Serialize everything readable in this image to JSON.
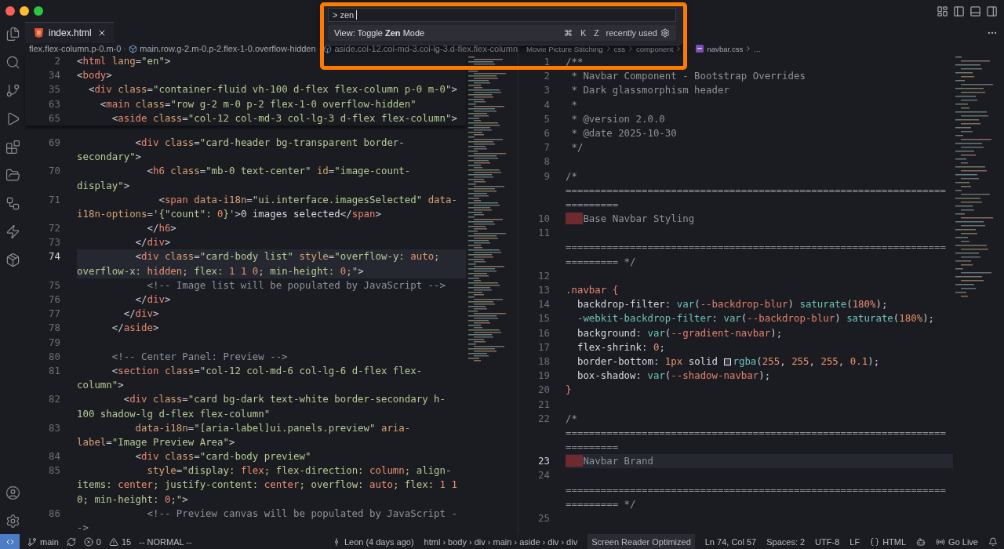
{
  "command_palette": {
    "value": "> zen",
    "item": {
      "label": "View: Toggle **Zen** Mode",
      "keys": [
        "⌘",
        "K",
        "Z"
      ],
      "note": "recently used"
    }
  },
  "editor_left": {
    "kind": "html",
    "tabs": [
      {
        "label": "index.html",
        "kind": "html",
        "selected": true
      }
    ],
    "breadcrumbs": [
      {
        "kind": "plain",
        "label": "flex.flex-column.p-0.m-0"
      },
      {
        "kind": "symbol",
        "label": "main.row.g-2.m-0.p-2.flex-1-0.overflow-hidden"
      },
      {
        "kind": "symbol",
        "label": "aside.col-12.col-md-3.col-lg-3.d-flex.flex-column"
      }
    ],
    "sticky_lines": [
      {
        "n": "2",
        "text": "<html lang=\"en\">"
      },
      {
        "n": "34",
        "text": "<body>"
      },
      {
        "n": "35",
        "text": "  <div class=\"container-fluid vh-100 d-flex flex-column p-0 m-0\">"
      },
      {
        "n": "63",
        "text": "    <main class=\"row g-2 m-0 p-2 flex-1-0 overflow-hidden\""
      },
      {
        "n": "65",
        "text": "      <aside class=\"col-12 col-md-3 col-lg-3 d-flex flex-column\">"
      }
    ],
    "lines": [
      {
        "n": "69",
        "current": false,
        "text": "          <div class=\"card-header bg-transparent border-"
      },
      {
        "current": false,
        "kind": "string",
        "text": "secondary\">"
      },
      {
        "n": "70",
        "current": false,
        "text": "            <h6 class=\"mb-0 text-center\" id=\"image-count-"
      },
      {
        "current": false,
        "kind": "string",
        "text": "display\">"
      },
      {
        "n": "71",
        "current": false,
        "text": "              <span data-i18n=\"ui.interface.imagesSelected\" data-"
      },
      {
        "current": false,
        "kind": "tag",
        "text": "i18n-options='{\"count\": 0}'>0 images selected</span>"
      },
      {
        "n": "72",
        "current": false,
        "text": "            </h6>"
      },
      {
        "n": "73",
        "current": false,
        "text": "          </div>"
      },
      {
        "n": "74",
        "current": true,
        "text": "          <div class=\"card-body list\" style=\"overflow-y: auto;"
      },
      {
        "current": true,
        "kind": "string",
        "text": "overflow-x: hidden; flex: 1 1 0; min-height: 0;\">"
      },
      {
        "n": "75",
        "current": false,
        "text": "            <!-- Image list will be populated by JavaScript -->"
      },
      {
        "n": "76",
        "current": false,
        "text": "          </div>"
      },
      {
        "n": "77",
        "current": false,
        "text": "        </div>"
      },
      {
        "n": "78",
        "current": false,
        "text": "      </aside>"
      },
      {
        "n": "79",
        "current": false
      },
      {
        "n": "80",
        "current": false,
        "text": "      <!-- Center Panel: Preview -->"
      },
      {
        "n": "81",
        "current": false,
        "text": "      <section class=\"col-12 col-md-6 col-lg-6 d-flex flex-"
      },
      {
        "current": false,
        "kind": "string",
        "text": "column\">"
      },
      {
        "n": "82",
        "current": false,
        "text": "        <div class=\"card bg-dark text-white border-secondary h-"
      },
      {
        "current": false,
        "kind": "string",
        "text": "100 shadow-lg d-flex flex-column\""
      },
      {
        "n": "83",
        "current": false,
        "kind": "tag",
        "text": "          data-i18n=\"[aria-label]ui.panels.preview\" aria-"
      },
      {
        "current": false,
        "kind": "tag",
        "text": "label=\"Image Preview Area\">"
      },
      {
        "n": "84",
        "current": false,
        "text": "          <div class=\"card-body preview\""
      },
      {
        "n": "85",
        "current": false,
        "kind": "tag",
        "text": "            style=\"display: flex; flex-direction: column; align-"
      },
      {
        "current": false,
        "kind": "string",
        "text": "items: center; justify-content: center; overflow: auto; flex: 1 1"
      },
      {
        "current": false,
        "kind": "string",
        "text": "0; min-height: 0;\">"
      },
      {
        "n": "86",
        "current": false,
        "text": "            <!-- Preview canvas will be populated by JavaScript -"
      },
      {
        "current": false,
        "kind": "comment",
        "text": "->"
      }
    ]
  },
  "editor_right": {
    "kind": "css",
    "breadcrumbs": [
      {
        "kind": "plain",
        "label": "Movie Picture Stitching"
      },
      {
        "kind": "plain",
        "label": "css"
      },
      {
        "kind": "plain",
        "label": "component"
      },
      {
        "kind": "file",
        "label": "navbar.css"
      },
      {
        "kind": "plain",
        "label": "..."
      }
    ],
    "lines": [
      {
        "n": "1",
        "current": false,
        "text": "/**"
      },
      {
        "n": "2",
        "current": false,
        "text": " * Navbar Component - Bootstrap Overrides"
      },
      {
        "n": "3",
        "current": false,
        "text": " * Dark glassmorphism header"
      },
      {
        "n": "4",
        "current": false,
        "text": " *"
      },
      {
        "n": "5",
        "current": false,
        "text": " * @version 2.0.0"
      },
      {
        "n": "6",
        "current": false,
        "text": " * @date 2025-10-30"
      },
      {
        "n": "7",
        "current": false,
        "text": " */"
      },
      {
        "n": "8",
        "current": false
      },
      {
        "n": "9",
        "current": false,
        "text": "/*"
      },
      {
        "current": false,
        "kind": "comment",
        "text": "================================================================="
      },
      {
        "current": false,
        "kind": "comment",
        "text": "========="
      },
      {
        "n": "10",
        "current": false,
        "indent_error": true,
        "kind": "comment",
        "text": "Base Navbar Styling"
      },
      {
        "n": "11",
        "current": false
      },
      {
        "current": false,
        "kind": "comment",
        "text": "================================================================="
      },
      {
        "current": false,
        "kind": "comment",
        "text": "========= */"
      },
      {
        "n": "12",
        "current": false
      },
      {
        "n": "13",
        "current": false,
        "text": ".navbar {"
      },
      {
        "n": "14",
        "current": false,
        "text": "  backdrop-filter: var(--backdrop-blur) saturate(180%);"
      },
      {
        "n": "15",
        "current": false,
        "text": "  -webkit-backdrop-filter: var(--backdrop-blur) saturate(180%);"
      },
      {
        "n": "16",
        "current": false,
        "text": "  background: var(--gradient-navbar);"
      },
      {
        "n": "17",
        "current": false,
        "text": "  flex-shrink: 0;"
      },
      {
        "n": "18",
        "current": false,
        "text": "  border-bottom: 1px solid rgba(255, 255, 255, 0.1);"
      },
      {
        "n": "19",
        "current": false,
        "text": "  box-shadow: var(--shadow-navbar);"
      },
      {
        "n": "20",
        "current": false,
        "text": "}"
      },
      {
        "n": "21",
        "current": false
      },
      {
        "n": "22",
        "current": false,
        "text": "/*"
      },
      {
        "current": false,
        "kind": "comment",
        "text": "================================================================="
      },
      {
        "current": false,
        "kind": "comment",
        "text": "========="
      },
      {
        "n": "23",
        "current": true,
        "indent_error": true,
        "kind": "comment",
        "text": "Navbar Brand"
      },
      {
        "n": "24",
        "current": false
      },
      {
        "current": false,
        "kind": "comment",
        "text": "================================================================="
      },
      {
        "current": false,
        "kind": "comment",
        "text": "========= */"
      },
      {
        "n": "25",
        "current": false
      }
    ]
  },
  "status_bar": {
    "left": [
      {
        "kind": "branch",
        "label": "main"
      },
      {
        "kind": "sync"
      },
      {
        "kind": "errors",
        "label": "0"
      },
      {
        "kind": "warnings",
        "label": "15"
      },
      {
        "kind": "plain",
        "label": "-- NORMAL --"
      }
    ],
    "right": [
      {
        "kind": "blame",
        "label": "Leon (4 days ago)"
      },
      {
        "kind": "plain",
        "label": "html › body › div › main › aside › div › div"
      },
      {
        "kind": "highlighted",
        "label": "Screen Reader Optimized"
      },
      {
        "kind": "plain",
        "label": "Ln 74, Col 57"
      },
      {
        "kind": "plain",
        "label": "Spaces: 2"
      },
      {
        "kind": "plain",
        "label": "UTF-8"
      },
      {
        "kind": "plain",
        "label": "LF"
      },
      {
        "kind": "language",
        "label": "HTML"
      },
      {
        "kind": "copilot"
      },
      {
        "kind": "live",
        "label": "Go Live"
      },
      {
        "kind": "bell"
      }
    ]
  }
}
